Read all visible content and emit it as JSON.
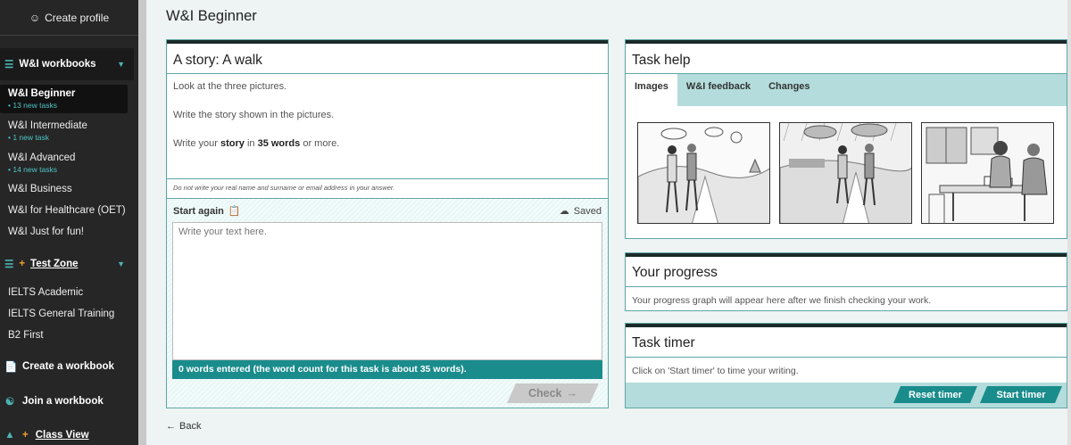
{
  "sidebar": {
    "create_profile": "Create profile",
    "workbooks_label": "W&I workbooks",
    "items": [
      {
        "label": "W&I Beginner",
        "sub": "• 13 new tasks"
      },
      {
        "label": "W&I Intermediate",
        "sub": "• 1 new task"
      },
      {
        "label": "W&I Advanced",
        "sub": "• 14 new tasks"
      },
      {
        "label": "W&I Business"
      },
      {
        "label": "W&I for Healthcare (OET)"
      },
      {
        "label": "W&I Just for fun!"
      }
    ],
    "test_zone_label": "Test Zone",
    "test_items": [
      "IELTS Academic",
      "IELTS General Training",
      "B2 First"
    ],
    "create_workbook": "Create a workbook",
    "join_workbook": "Join a workbook",
    "class_view": "Class View"
  },
  "page_title": "W&I Beginner",
  "story": {
    "title": "A story: A walk",
    "line1": "Look at the three pictures.",
    "line2": "Write the story shown in the pictures.",
    "line3_pre": "Write your ",
    "line3_bold1": "story",
    "line3_mid": " in ",
    "line3_bold2": "35 words",
    "line3_post": " or more.",
    "note": "Do not write your real name and surname or email address in your answer.",
    "start_again": "Start again",
    "saved": "Saved",
    "placeholder": "Write your text here.",
    "word_count": "0 words entered (the word count for this task is about 35 words).",
    "check": "Check"
  },
  "back": "Back",
  "task_help": {
    "title": "Task help",
    "tabs": [
      "Images",
      "W&I feedback",
      "Changes"
    ]
  },
  "progress": {
    "title": "Your progress",
    "body": "Your progress graph will appear here after we finish checking your work."
  },
  "timer": {
    "title": "Task timer",
    "body": "Click on 'Start timer' to time your writing.",
    "reset": "Reset timer",
    "start": "Start timer"
  }
}
